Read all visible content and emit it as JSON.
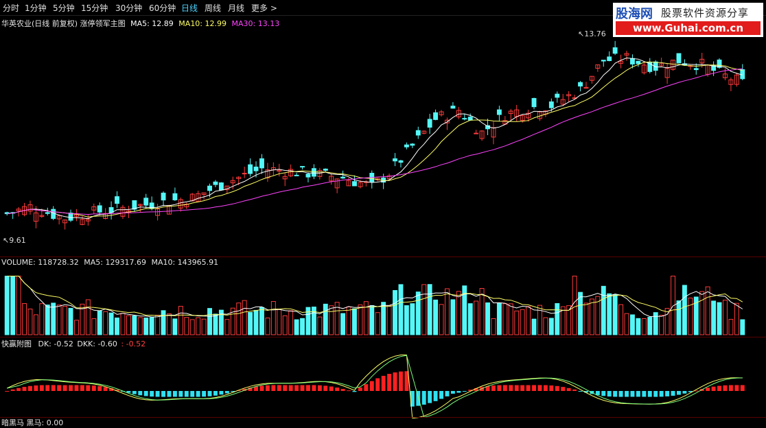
{
  "tabs": [
    "分时",
    "1分钟",
    "5分钟",
    "15分钟",
    "30分钟",
    "60分钟",
    "日线",
    "周线",
    "月线",
    "更多 >"
  ],
  "active_tab": "日线",
  "main_info": {
    "title": "华英农业(日线 前复权) 涨停领军主图",
    "ma5": "MA5: 12.89",
    "ma10": "MA10: 12.99",
    "ma30": "MA30: 13.13"
  },
  "price_labels": {
    "high": "13.76",
    "low": "9.61"
  },
  "volume_info": {
    "volume": "VOLUME: 118728.32",
    "ma5": "MA5: 129317.69",
    "ma10": "MA10: 143965.91"
  },
  "indicator_info": {
    "name": "快赢附图",
    "dk": "DK: -0.52",
    "dkk": "DKK: -0.60",
    "extra": ": -0.52"
  },
  "bottom_label": "暗黑马  黑马: 0.00",
  "logo": {
    "brand": "股海网",
    "slogan": "股票软件资源分享",
    "url": "www.Guhai.com.cn"
  },
  "colors": {
    "up": "#ff3b3b",
    "down": "#54f7f7",
    "ma5": "#ffffff",
    "ma10": "#ffff66",
    "ma30": "#ff44ff",
    "active_tab": "#4fd3ff",
    "macd_pos": "#ff2020",
    "macd_neg": "#30e0f0"
  },
  "chart_data": {
    "type": "candlestick",
    "price_range": [
      9.3,
      14.2
    ],
    "high": 13.76,
    "low": 9.61,
    "ma5_last": 12.89,
    "ma10_last": 12.99,
    "ma30_last": 13.13,
    "volume_last": 118728.32,
    "volume_ma5": 129317.69,
    "volume_ma10": 143965.91,
    "dk": -0.52,
    "dkk": -0.6
  }
}
